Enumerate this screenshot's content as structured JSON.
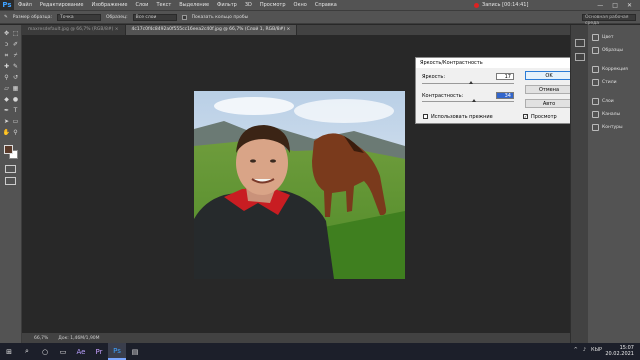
{
  "app": {
    "logo": "Ps"
  },
  "menu": [
    "Файл",
    "Редактирование",
    "Изображение",
    "Слои",
    "Текст",
    "Выделение",
    "Фильтр",
    "3D",
    "Просмотр",
    "Окно",
    "Справка"
  ],
  "recording": "Запись [00:14:41]",
  "window_controls": [
    "—",
    "□",
    "✕"
  ],
  "options_bar": {
    "tool_size_label": "Размер образца:",
    "tool_size_value": "Точка",
    "sample_label": "Образец:",
    "sample_value": "Все слои",
    "show_ring_label": "Показать кольцо пробы",
    "workspace_button": "Основная рабочая среда"
  },
  "tabs": [
    {
      "label": "maxresdefault.jpg @ 66,7% (RGB/8#) ×",
      "active": false
    },
    {
      "label": "4c17c0f4c8492a0f555cc16eea2c40f.jpg @ 66,7% (Слой 1, RGB/8#) ×",
      "active": true
    }
  ],
  "status": {
    "zoom": "66,7%",
    "doc": "Док: 1,46M/1,90M"
  },
  "panels": {
    "group1": [
      "Цвет",
      "Образцы"
    ],
    "group2": [
      "Коррекция",
      "Стили"
    ],
    "group3": [
      "Слои",
      "Каналы",
      "Контуры"
    ]
  },
  "dialog": {
    "title": "Яркость/Контрастность",
    "close": "✕",
    "brightness_label": "Яркость:",
    "brightness_value": "17",
    "brightness_level": 0.53,
    "contrast_label": "Контрастность:",
    "contrast_value": "34",
    "contrast_level": 0.56,
    "ok": "OK",
    "cancel": "Отмена",
    "auto": "Авто",
    "legacy_label": "Использовать прежние",
    "legacy_checked": false,
    "preview_label": "Просмотр",
    "preview_checked": true
  },
  "taskbar": {
    "apps": [
      "⊞",
      "⌕",
      "○",
      "▭",
      "Ae",
      "Pr",
      "Ps",
      "▤"
    ],
    "active_app": 6,
    "tray": [
      "^",
      "♪",
      "КЫР"
    ],
    "time": "15:07",
    "date": "20.02.2021"
  },
  "colors": {
    "fg_swatch": "#5a3a2a",
    "bg_swatch": "#ffffff",
    "accent": "#3ea1ff"
  }
}
